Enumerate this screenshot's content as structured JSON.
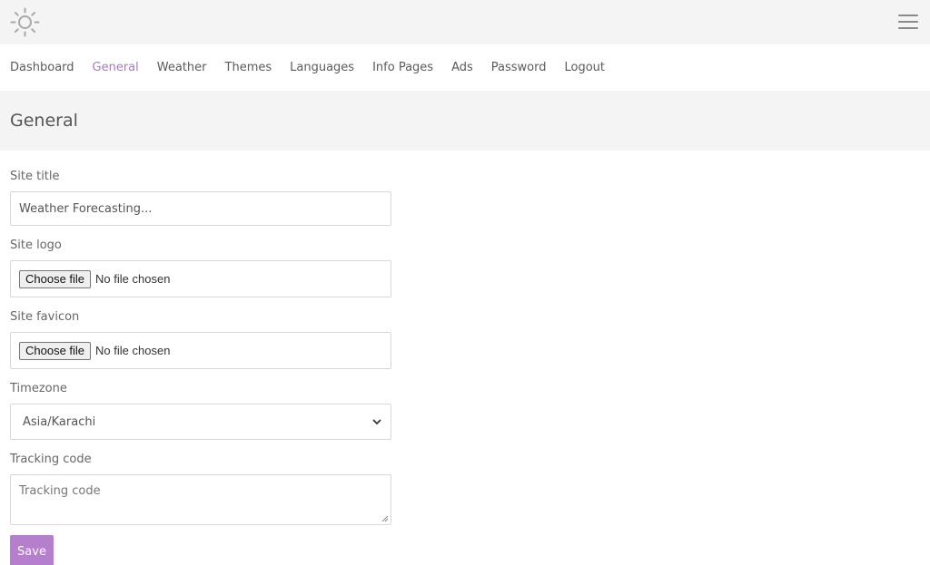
{
  "nav": {
    "items": [
      {
        "label": "Dashboard"
      },
      {
        "label": "General"
      },
      {
        "label": "Weather"
      },
      {
        "label": "Themes"
      },
      {
        "label": "Languages"
      },
      {
        "label": "Info Pages"
      },
      {
        "label": "Ads"
      },
      {
        "label": "Password"
      },
      {
        "label": "Logout"
      }
    ],
    "active": "General"
  },
  "page": {
    "title": "General"
  },
  "form": {
    "site_title": {
      "label": "Site title",
      "value": "Weather Forecasting..."
    },
    "site_logo": {
      "label": "Site logo",
      "button": "Choose file",
      "status": "No file chosen"
    },
    "site_favicon": {
      "label": "Site favicon",
      "button": "Choose file",
      "status": "No file chosen"
    },
    "timezone": {
      "label": "Timezone",
      "value": "Asia/Karachi"
    },
    "tracking_code": {
      "label": "Tracking code",
      "placeholder": "Tracking code"
    },
    "save_label": "Save"
  },
  "icons": {
    "logo": "sun-icon",
    "menu": "hamburger-menu-icon",
    "select": "chevron-down-icon"
  },
  "colors": {
    "accent": "#b174c9",
    "save_button": "#b67fce",
    "header_bg": "#f4f4f4"
  }
}
